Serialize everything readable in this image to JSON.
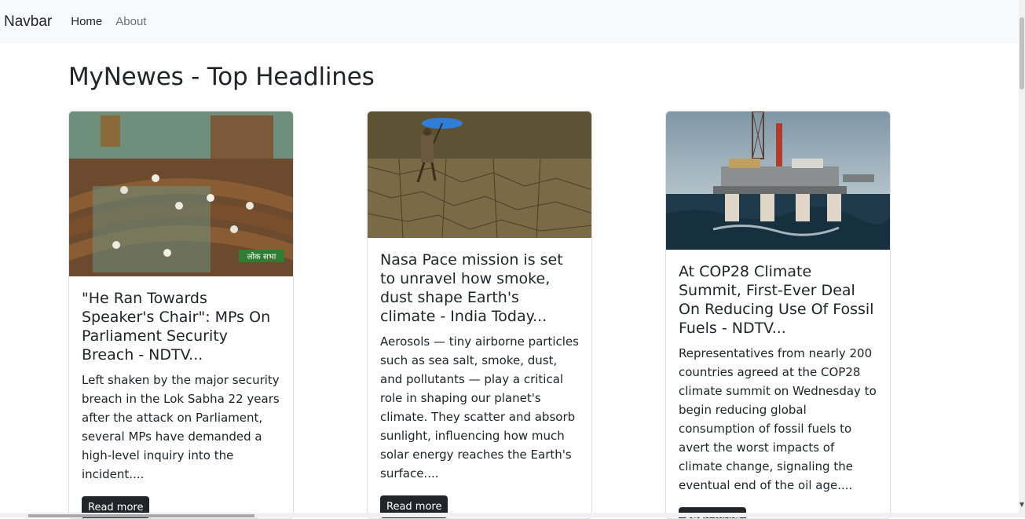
{
  "navbar": {
    "brand": "Navbar",
    "links": [
      {
        "label": "Home"
      },
      {
        "label": "About"
      }
    ]
  },
  "page": {
    "title": "MyNewes - Top Headlines"
  },
  "articles": [
    {
      "title": "\"He Ran Towards Speaker's Chair\": MPs On Parliament Security Breach - NDTV...",
      "description": "Left shaken by the major security breach in the Lok Sabha 22 years after the attack on Parliament, several MPs have demanded a high-level inquiry into the incident....",
      "button_label": "Read more",
      "image_caption": "लोक सभा"
    },
    {
      "title": "Nasa Pace mission is set to unravel how smoke, dust shape Earth's climate - India Today...",
      "description": "Aerosols — tiny airborne particles such as sea salt, smoke, dust, and pollutants — play a critical role in shaping our planet's climate. They scatter and absorb sunlight, influencing how much solar energy reaches the Earth's surface....",
      "button_label": "Read more"
    },
    {
      "title": "At COP28 Climate Summit, First-Ever Deal On Reducing Use Of Fossil Fuels - NDTV...",
      "description": "Representatives from nearly 200 countries agreed at the COP28 climate summit on Wednesday to begin reducing global consumption of fossil fuels to avert the worst impacts of climate change, signaling the eventual end of the oil age....",
      "button_label": "Read more"
    }
  ],
  "colors": {
    "navbar_bg": "#f8f9fa",
    "button_bg": "#212529",
    "text": "#212529",
    "muted": "#6c757d"
  }
}
